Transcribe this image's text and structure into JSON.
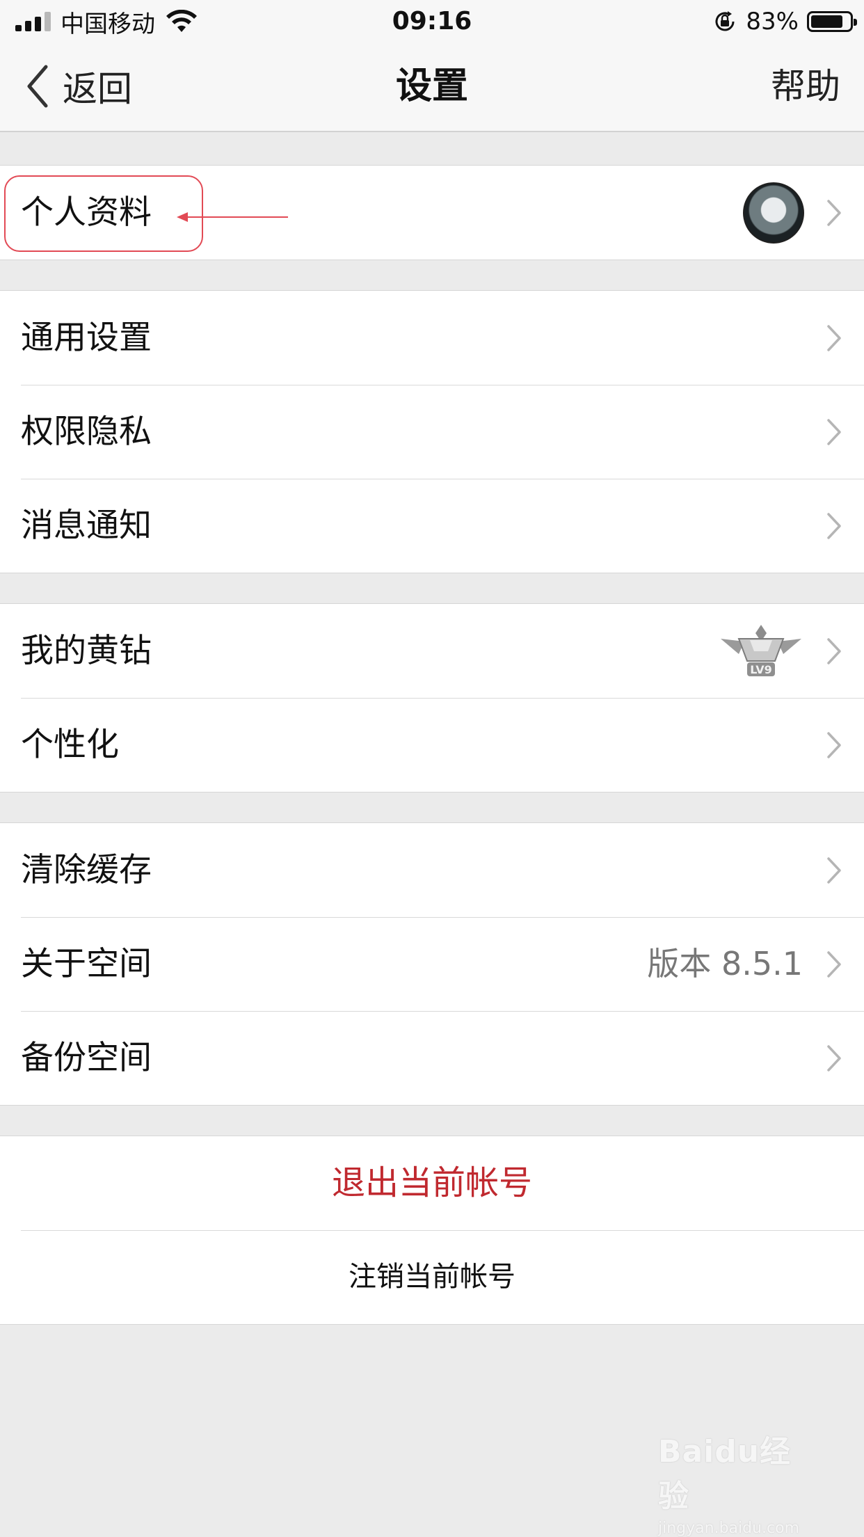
{
  "status_bar": {
    "carrier": "中国移动",
    "time": "09:16",
    "battery_percent": "83%",
    "battery_level": 0.83
  },
  "nav": {
    "back_label": "返回",
    "title": "设置",
    "help_label": "帮助"
  },
  "groups": {
    "profile": {
      "label": "个人资料"
    },
    "general": [
      {
        "label": "通用设置"
      },
      {
        "label": "权限隐私"
      },
      {
        "label": "消息通知"
      }
    ],
    "vip": {
      "yellow_diamond": {
        "label": "我的黄钻",
        "badge_text": "LV9"
      },
      "personalize": {
        "label": "个性化"
      }
    },
    "system": {
      "clear_cache": {
        "label": "清除缓存"
      },
      "about": {
        "label": "关于空间",
        "value": "版本 8.5.1"
      },
      "backup": {
        "label": "备份空间"
      }
    },
    "account": {
      "logout_label": "退出当前帐号",
      "deactivate_label": "注销当前帐号"
    }
  },
  "watermark": {
    "logo_text": "Baidu经验",
    "url": "jingyan.baidu.com"
  },
  "colors": {
    "accent_red": "#c0292f",
    "annotation_red": "#e24a55",
    "background": "#ebebeb"
  }
}
